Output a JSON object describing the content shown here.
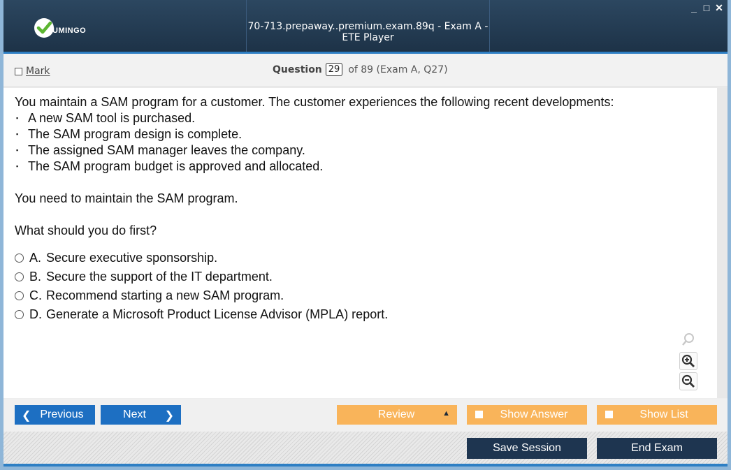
{
  "app": {
    "brand": "UMINGO",
    "window_title": "70-713.prepaway..premium.exam.89q - Exam A - ETE Player",
    "window_controls": [
      "_",
      "□",
      "✕"
    ]
  },
  "header": {
    "mark_label": "Mark",
    "question_label": "Question",
    "question_number": "29",
    "question_of": "of 89 (Exam A, Q27)"
  },
  "question": {
    "intro": "You maintain a SAM program for a customer. The customer experiences the following recent developments:",
    "bullets": [
      "A new SAM tool is purchased.",
      "The SAM program design is complete.",
      "The assigned SAM manager leaves the company.",
      "The SAM program budget is approved and allocated."
    ],
    "need": "You need to maintain the SAM program.",
    "prompt": "What should you do first?",
    "options": [
      {
        "letter": "A.",
        "text": "Secure executive sponsorship."
      },
      {
        "letter": "B.",
        "text": "Secure the support of the IT department."
      },
      {
        "letter": "C.",
        "text": "Recommend starting a new SAM program."
      },
      {
        "letter": "D.",
        "text": "Generate a Microsoft Product License Advisor (MPLA) report."
      }
    ]
  },
  "zoom_icons": [
    "search-icon",
    "zoom-in-icon",
    "zoom-out-icon"
  ],
  "nav": {
    "previous": "Previous",
    "next": "Next",
    "review": "Review",
    "show_answer": "Show Answer",
    "show_list": "Show List"
  },
  "footer": {
    "save_session": "Save Session",
    "end_exam": "End Exam"
  },
  "colors": {
    "titlebar": "#1d3247",
    "accent_blue": "#1d6fc2",
    "accent_orange": "#f9b45a",
    "footer_button": "#1e3550"
  }
}
